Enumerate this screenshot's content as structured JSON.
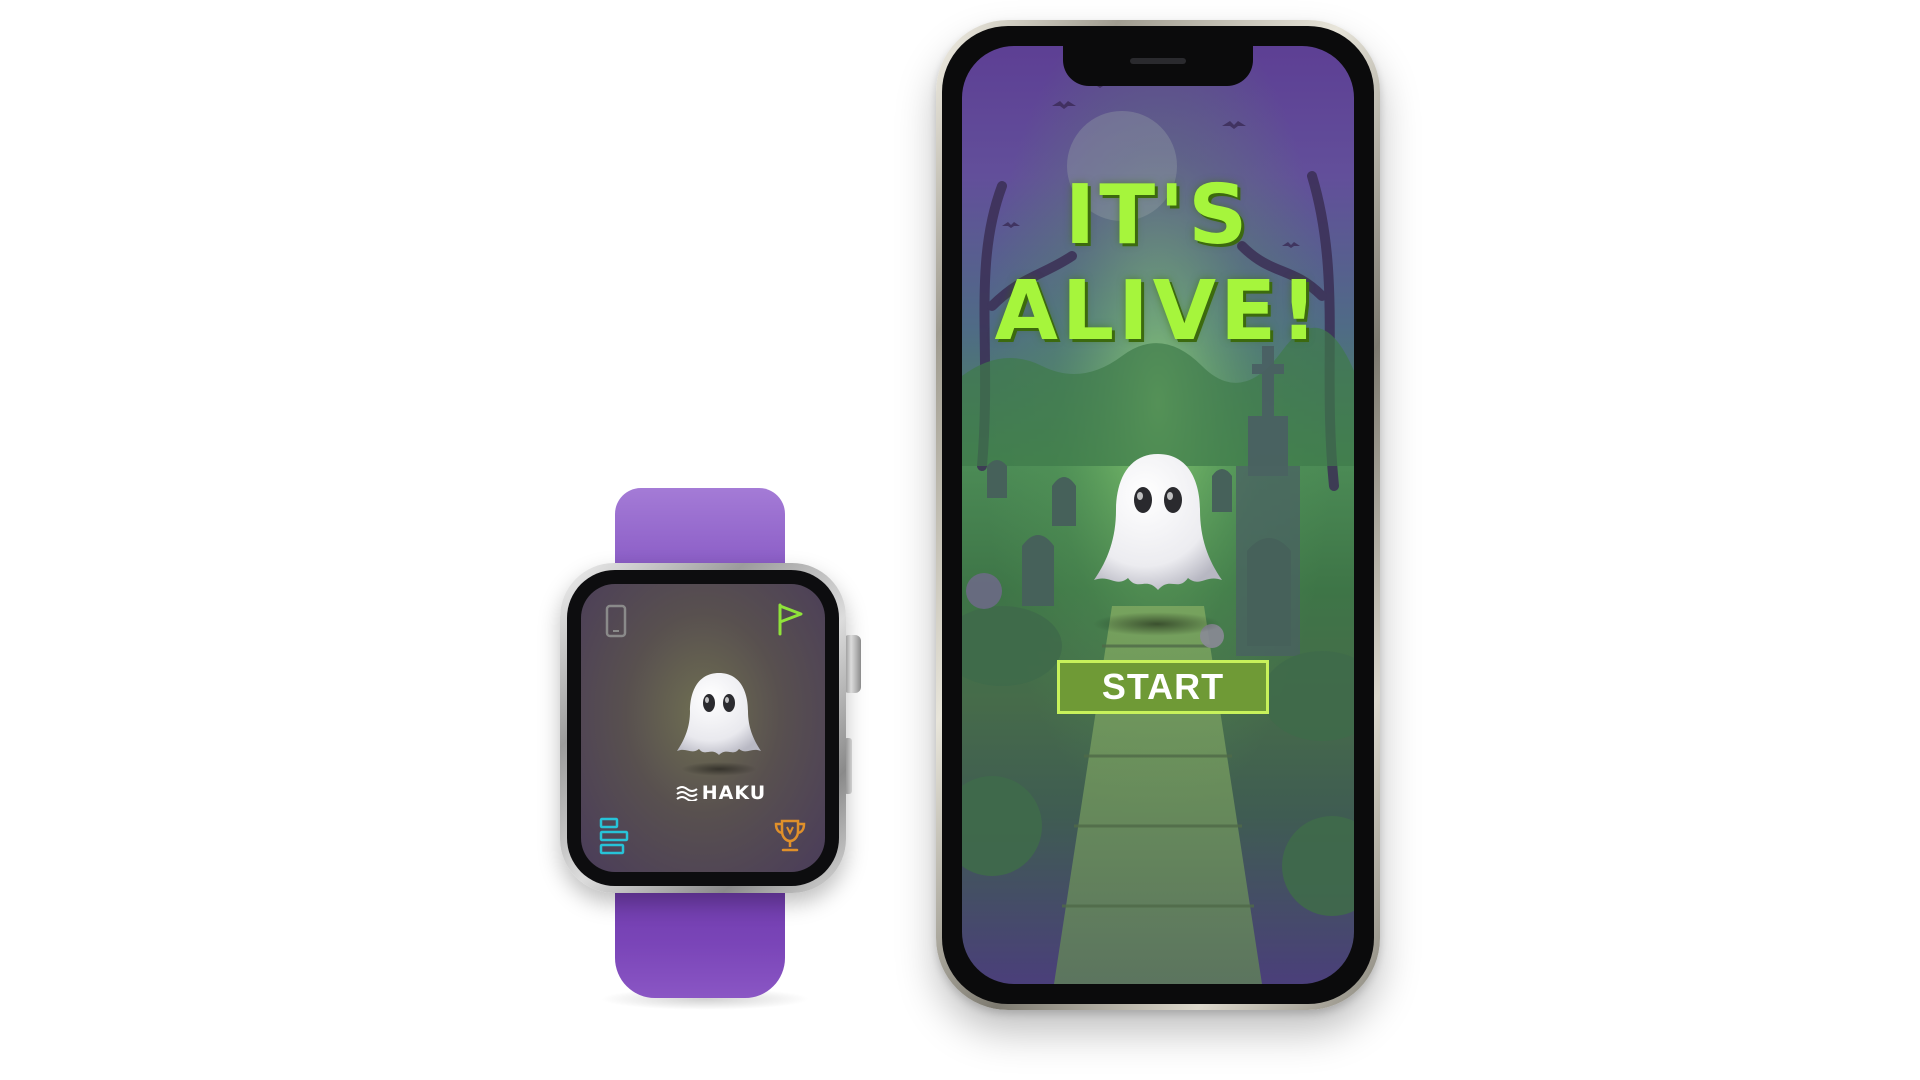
{
  "watch": {
    "app_logo_text": "HAKU",
    "icons": {
      "top_left": "phone-icon",
      "top_right": "flag-icon",
      "center": "ghost-icon",
      "bottom_left": "list-icon",
      "bottom_right": "trophy-icon"
    },
    "colors": {
      "band": "#8a5cc6",
      "flag": "#8fe33a",
      "list": "#27c3d8",
      "trophy": "#e0902a"
    }
  },
  "phone": {
    "title_line1": "IT'S",
    "title_line2": "ALIVE!",
    "start_label": "START",
    "colors": {
      "title": "#a6f53c",
      "start_bg": "#6f9a36",
      "start_border": "#c8f25b"
    }
  }
}
